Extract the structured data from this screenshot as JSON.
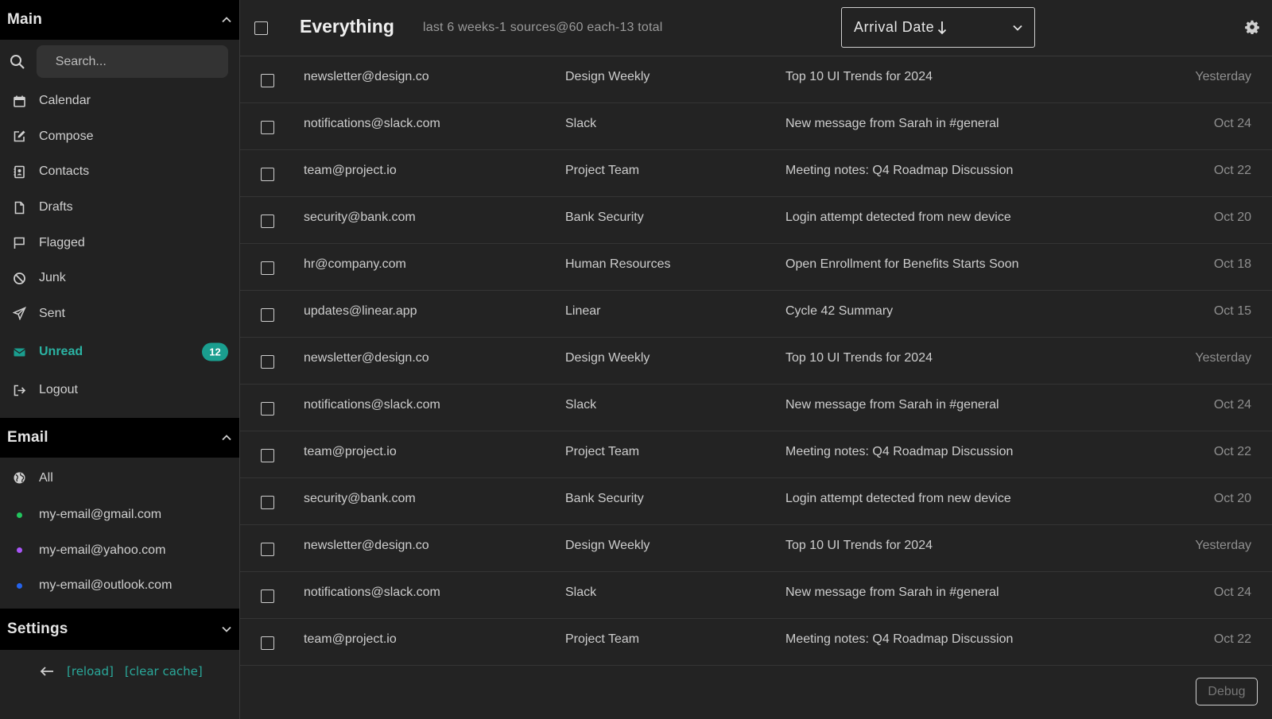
{
  "sidebar": {
    "main_section": {
      "title": "Main",
      "chevron_icon": "chevron-up-icon"
    },
    "search": {
      "placeholder": "Search...",
      "icon": "search-icon"
    },
    "nav": [
      {
        "label": "Calendar",
        "icon": "calendar-icon"
      },
      {
        "label": "Compose",
        "icon": "compose-icon"
      },
      {
        "label": "Contacts",
        "icon": "contacts-icon"
      },
      {
        "label": "Drafts",
        "icon": "file-icon"
      },
      {
        "label": "Flagged",
        "icon": "flag-icon"
      },
      {
        "label": "Junk",
        "icon": "ban-icon"
      },
      {
        "label": "Sent",
        "icon": "send-icon"
      },
      {
        "label": "Unread",
        "icon": "envelope-icon",
        "badge": "12",
        "active": true
      },
      {
        "label": "Logout",
        "icon": "logout-icon"
      }
    ],
    "email_section": {
      "title": "Email",
      "chevron_icon": "chevron-up-icon"
    },
    "accounts": [
      {
        "label": "All",
        "icon": "globe-icon"
      },
      {
        "label": "my-email@gmail.com",
        "dot_color": "#22c55e"
      },
      {
        "label": "my-email@yahoo.com",
        "dot_color": "#a855f7"
      },
      {
        "label": "my-email@outlook.com",
        "dot_color": "#2563eb"
      }
    ],
    "settings_section": {
      "title": "Settings",
      "chevron_icon": "chevron-down-icon"
    },
    "footer": {
      "back_icon": "arrow-left-icon",
      "reload": "[reload]",
      "clear_cache": "[clear cache]"
    }
  },
  "toolbar": {
    "title": "Everything",
    "meta": "last 6 weeks-1 sources@60 each-13 total",
    "sort": {
      "value": "Arrival Date",
      "direction_icon": "arrow-down-icon"
    },
    "settings_icon": "gear-icon"
  },
  "messages": [
    {
      "from": "newsletter@design.co",
      "sender": "Design Weekly",
      "subject": "Top 10 UI Trends for 2024",
      "date": "Yesterday"
    },
    {
      "from": "notifications@slack.com",
      "sender": "Slack",
      "subject": "New message from Sarah in #general",
      "date": "Oct 24"
    },
    {
      "from": "team@project.io",
      "sender": "Project Team",
      "subject": "Meeting notes: Q4 Roadmap Discussion",
      "date": "Oct 22"
    },
    {
      "from": "security@bank.com",
      "sender": "Bank Security",
      "subject": "Login attempt detected from new device",
      "date": "Oct 20"
    },
    {
      "from": "hr@company.com",
      "sender": "Human Resources",
      "subject": "Open Enrollment for Benefits Starts Soon",
      "date": "Oct 18"
    },
    {
      "from": "updates@linear.app",
      "sender": "Linear",
      "subject": "Cycle 42 Summary",
      "date": "Oct 15"
    },
    {
      "from": "newsletter@design.co",
      "sender": "Design Weekly",
      "subject": "Top 10 UI Trends for 2024",
      "date": "Yesterday"
    },
    {
      "from": "notifications@slack.com",
      "sender": "Slack",
      "subject": "New message from Sarah in #general",
      "date": "Oct 24"
    },
    {
      "from": "team@project.io",
      "sender": "Project Team",
      "subject": "Meeting notes: Q4 Roadmap Discussion",
      "date": "Oct 22"
    },
    {
      "from": "security@bank.com",
      "sender": "Bank Security",
      "subject": "Login attempt detected from new device",
      "date": "Oct 20"
    },
    {
      "from": "newsletter@design.co",
      "sender": "Design Weekly",
      "subject": "Top 10 UI Trends for 2024",
      "date": "Yesterday"
    },
    {
      "from": "notifications@slack.com",
      "sender": "Slack",
      "subject": "New message from Sarah in #general",
      "date": "Oct 24"
    },
    {
      "from": "team@project.io",
      "sender": "Project Team",
      "subject": "Meeting notes: Q4 Roadmap Discussion",
      "date": "Oct 22"
    }
  ],
  "debug": {
    "label": "Debug"
  },
  "colors": {
    "accent": "#1a9e8f",
    "accent_text": "#2bb3a3",
    "background": "#222222",
    "section_header": "#000000"
  }
}
